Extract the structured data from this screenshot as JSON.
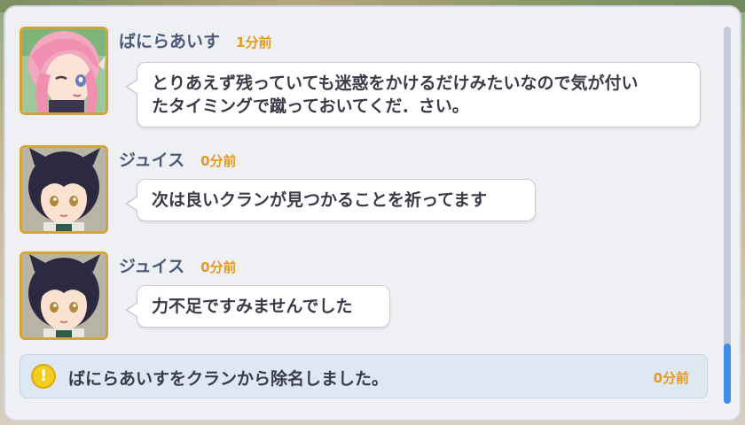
{
  "messages": [
    {
      "avatar_icon": "pink-hair-elf-girl-avatar",
      "name": "ばにらあいす",
      "time": "1分前",
      "text_line1": "とりあえず残っていても迷惑をかけるだけみたいなので気が付い",
      "text_line2": "たタイミングで蹴っておいてくだ．さい。"
    },
    {
      "avatar_icon": "dark-hair-cat-girl-avatar",
      "name": "ジュイス",
      "time": "0分前",
      "text": "次は良いクランが見つかることを祈ってます"
    },
    {
      "avatar_icon": "dark-hair-cat-girl-avatar",
      "name": "ジュイス",
      "time": "0分前",
      "text": "力不足ですみませんでした"
    }
  ],
  "system_notice": {
    "icon": "exclamation-icon",
    "icon_glyph": "!",
    "text": "ばにらあいすをクランから除名しました。",
    "time": "0分前"
  },
  "colors": {
    "name": "#4a5a7a",
    "time": "#e49a1e",
    "scroll_thumb": "#3d8fe8",
    "notice_bg": "#dde8f2"
  }
}
